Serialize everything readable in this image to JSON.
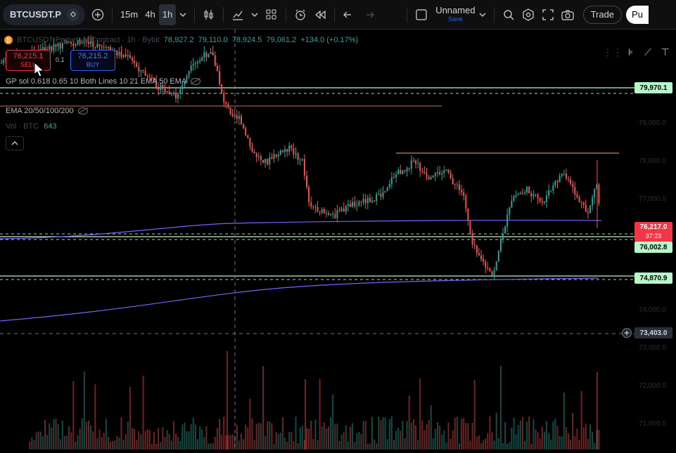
{
  "topbar": {
    "symbol": "BTCUSDT.P",
    "timeframes": [
      "15m",
      "4h",
      "1h"
    ],
    "active_timeframe": "1h",
    "layout_name": "Unnamed",
    "layout_status": "Save",
    "trade_label": "Trade",
    "publish_label": "Pu"
  },
  "legend": {
    "ohlc_open": "78,927.2",
    "ohlc_high": "79,110.0",
    "ohlc_low": "78,924.5",
    "ohlc_close": "79,061.2",
    "ohlc_change": "+134.0 (+0.17%)",
    "symbol_title": "BTCUSDT Perpetual Contract · 1h · Bybit",
    "sell_price": "76,215.1",
    "sell_label": "SELL",
    "buy_price": "76,215.2",
    "buy_label": "BUY",
    "spread": "0.1",
    "indicator1": "GP sol 0.618 0.65 10 Both Lines 10 21 EMA 50 EMA",
    "indicator2": "EMA 20/50/100/200",
    "volume_label": "Vol · BTC",
    "volume_value": "643"
  },
  "price_labels": {
    "level1": "79,970.1",
    "current": "76,217.0",
    "countdown": "37:23",
    "level2": "76,002.8",
    "level3": "74,870.9",
    "crosshair": "73,403.0"
  },
  "colors": {
    "up": "#26a69a",
    "down": "#ef5350",
    "ema": "#7b61ff",
    "level": "#b9f6ca",
    "resistance": "#f7a278"
  }
}
